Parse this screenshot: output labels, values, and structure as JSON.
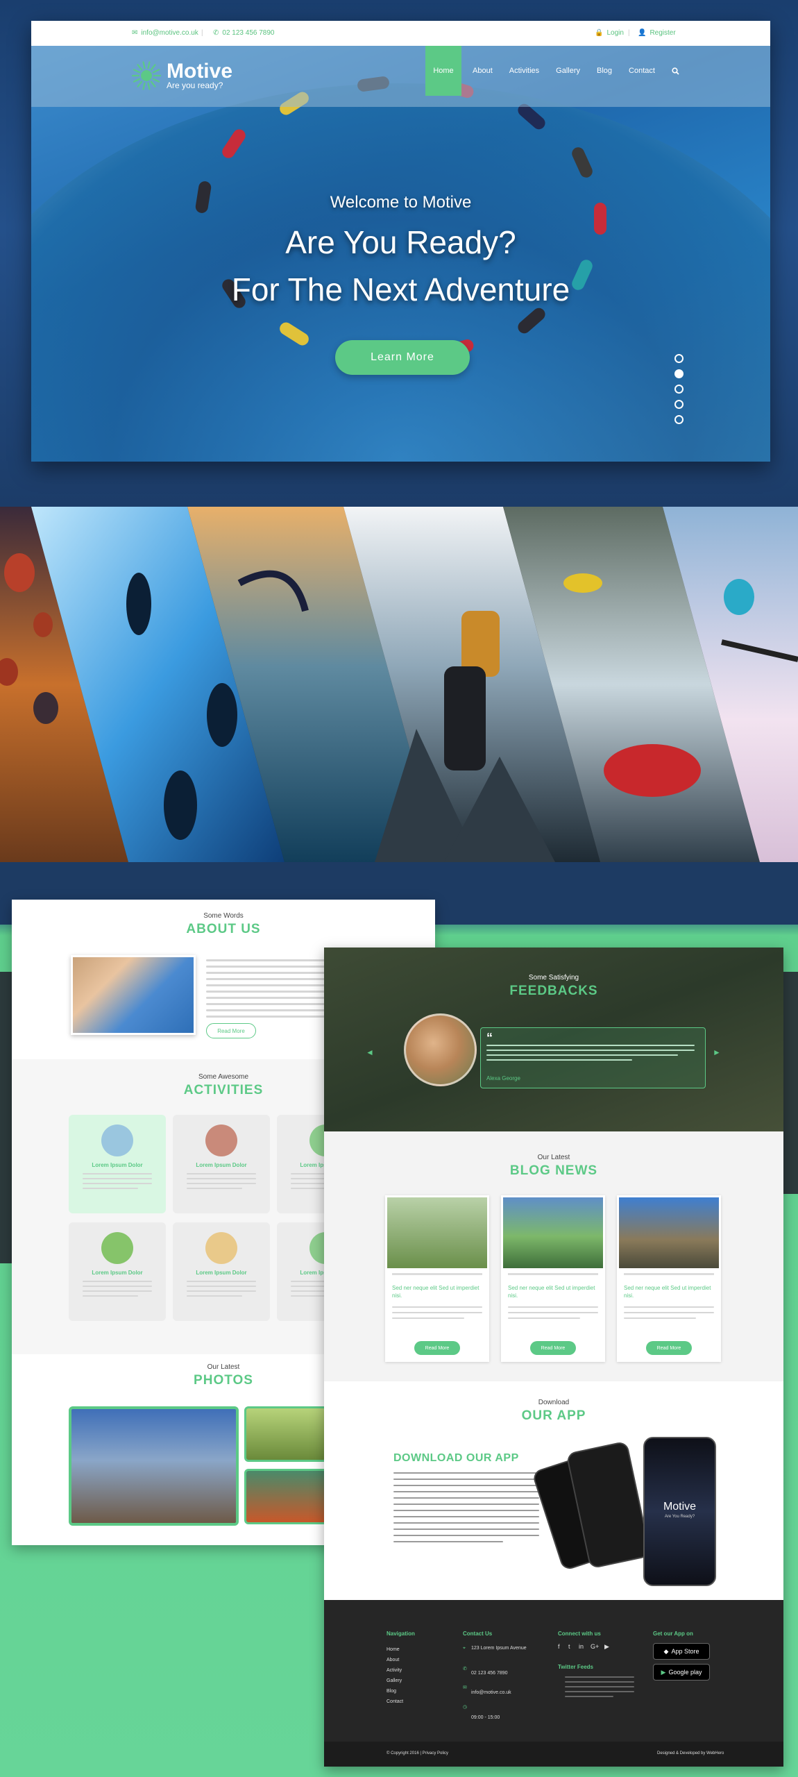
{
  "topbar": {
    "email": "info@motive.co.uk",
    "phone": "02 123 456 7890",
    "login": "Login",
    "register": "Register"
  },
  "logo": {
    "name": "Motive",
    "tagline": "Are you ready?"
  },
  "nav": {
    "items": [
      "Home",
      "About",
      "Activities",
      "Gallery",
      "Blog",
      "Contact"
    ],
    "active_index": 0,
    "search_icon": "search-icon"
  },
  "hero": {
    "welcome": "Welcome to Motive",
    "line1": "Are You Ready?",
    "line2": "For The Next Adventure",
    "cta": "Learn More",
    "slides": 5,
    "active_slide": 2
  },
  "about": {
    "subtitle": "Some Words",
    "title": "ABOUT US",
    "button": "Read More"
  },
  "activities": {
    "subtitle": "Some Awesome",
    "title": "ACTIVITIES",
    "items": [
      "Lorem Ipsum Dolor",
      "Lorem Ipsum Dolor",
      "Lorem Ipsum Dolor",
      "Lorem Ipsum Dolor",
      "Lorem Ipsum Dolor",
      "Lorem Ipsum Dolor"
    ]
  },
  "photos": {
    "subtitle": "Our Latest",
    "title": "PHOTOS"
  },
  "feedbacks": {
    "subtitle": "Some Satisfying",
    "title": "FEEDBACKS",
    "author": "Alexa George"
  },
  "blog": {
    "subtitle": "Our Latest",
    "title": "BLOG NEWS",
    "posts": [
      {
        "title": "Sed ner neque elit Sed ut imperdiet nisi.",
        "button": "Read More"
      },
      {
        "title": "Sed ner neque elit Sed ut imperdiet nisi.",
        "button": "Read More"
      },
      {
        "title": "Sed ner neque elit Sed ut imperdiet nisi.",
        "button": "Read More"
      }
    ]
  },
  "app": {
    "subtitle": "Download",
    "title": "OUR APP",
    "heading": "DOWNLOAD OUR APP",
    "phone_brand": "Motive",
    "phone_tag": "Are You Ready?"
  },
  "footer": {
    "nav_head": "Navigation",
    "nav_items": [
      "Home",
      "About",
      "Activity",
      "Gallery",
      "Blog",
      "Contact"
    ],
    "contact_head": "Contact Us",
    "contact_address": "123 Lorem Ipsum Avenue",
    "contact_phone": "02 123 456 7890",
    "contact_email": "info@motive.co.uk",
    "contact_hours": "09:00 - 15:00",
    "connect_head": "Connect with us",
    "twitter_head": "Twitter Feeds",
    "app_head": "Get our App on",
    "appstore": "App Store",
    "googleplay": "Google play",
    "copyright": "© Copyright 2016 | Privacy Policy",
    "credit": "Designed & Developed by WebHero"
  },
  "watermark": "Motive",
  "colors": {
    "accent": "#5cc986",
    "dark": "#262626",
    "navy": "#1d3a66"
  }
}
